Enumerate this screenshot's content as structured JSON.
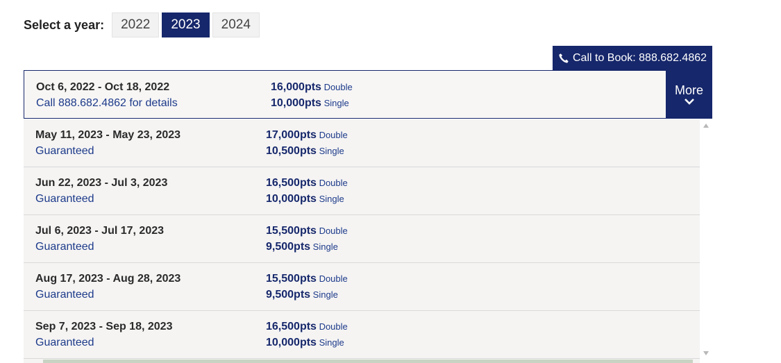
{
  "year_selector": {
    "label": "Select a year:",
    "years": [
      "2022",
      "2023",
      "2024"
    ],
    "selected": "2023"
  },
  "call_to_book": {
    "label": "Call to Book: 888.682.4862",
    "icon": "phone-icon"
  },
  "featured": {
    "dates": "Oct 6, 2022 - Oct 18, 2022",
    "status": "Call 888.682.4862 for details",
    "double_pts": "16,000pts",
    "double_label": "Double",
    "single_pts": "10,000pts",
    "single_label": "Single",
    "more_label": "More"
  },
  "departures": [
    {
      "dates": "May 11, 2023 - May 23, 2023",
      "status": "Guaranteed",
      "double_pts": "17,000pts",
      "double_label": "Double",
      "single_pts": "10,500pts",
      "single_label": "Single"
    },
    {
      "dates": "Jun 22, 2023 - Jul 3, 2023",
      "status": "Guaranteed",
      "double_pts": "16,500pts",
      "double_label": "Double",
      "single_pts": "10,000pts",
      "single_label": "Single"
    },
    {
      "dates": "Jul 6, 2023 - Jul 17, 2023",
      "status": "Guaranteed",
      "double_pts": "15,500pts",
      "double_label": "Double",
      "single_pts": "9,500pts",
      "single_label": "Single"
    },
    {
      "dates": "Aug 17, 2023 - Aug 28, 2023",
      "status": "Guaranteed",
      "double_pts": "15,500pts",
      "double_label": "Double",
      "single_pts": "9,500pts",
      "single_label": "Single"
    },
    {
      "dates": "Sep 7, 2023 - Sep 18, 2023",
      "status": "Guaranteed",
      "double_pts": "16,500pts",
      "double_label": "Double",
      "single_pts": "10,000pts",
      "single_label": "Single"
    }
  ],
  "colors": {
    "primary": "#16276b",
    "link": "#1d3a8a",
    "row_bg": "#f5f4f3"
  }
}
